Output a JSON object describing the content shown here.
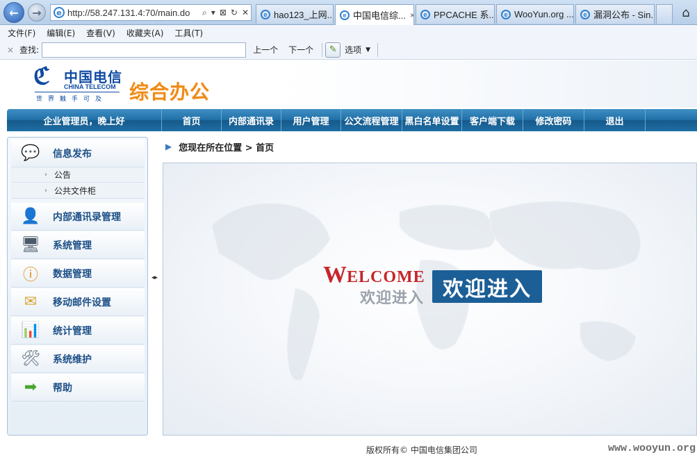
{
  "browser": {
    "address_url": "http://58.247.131.4:70/main.do",
    "address_controls": [
      "⌕",
      "▾",
      "⊠",
      "↻",
      "✕"
    ],
    "tabs": [
      {
        "title": "hao123_上网..."
      },
      {
        "title": "中国电信综...",
        "active": true,
        "close": "×"
      },
      {
        "title": "PPCACHE 系..."
      },
      {
        "title": "WooYun.org ..."
      },
      {
        "title": "漏洞公布 - Sin..."
      }
    ],
    "home_icon": "home-icon"
  },
  "menubar": {
    "items": [
      "文件(F)",
      "编辑(E)",
      "查看(V)",
      "收藏夹(A)",
      "工具(T)"
    ]
  },
  "findbar": {
    "close": "×",
    "label": "查找:",
    "input_value": "",
    "prev": "上一个",
    "next": "下一个",
    "options": "选项"
  },
  "header": {
    "logo_cn": "中国电信",
    "logo_en": "CHINA TELECOM",
    "logo_slogan": "世界触手可及",
    "app_title": "综合办公"
  },
  "nav": {
    "greeting": "企业管理员，晚上好",
    "items": [
      "首页",
      "内部通讯录",
      "用户管理",
      "公文流程管理",
      "黑白名单设置",
      "客户端下载",
      "修改密码",
      "退出"
    ]
  },
  "sidebar": {
    "groups": [
      {
        "label": "信息发布",
        "icon": "chat-bubbles-icon",
        "sub": [
          "公告",
          "公共文件柜"
        ]
      },
      {
        "label": "内部通讯录管理",
        "icon": "user-icon"
      },
      {
        "label": "系统管理",
        "icon": "monitor-icon"
      },
      {
        "label": "数据管理",
        "icon": "info-icon"
      },
      {
        "label": "移动邮件设置",
        "icon": "envelope-icon"
      },
      {
        "label": "统计管理",
        "icon": "bar-chart-icon"
      },
      {
        "label": "系统维护",
        "icon": "tools-icon"
      },
      {
        "label": "帮助",
        "icon": "arrow-right-icon"
      }
    ]
  },
  "breadcrumb": {
    "text": "您现在所在位置 > 首页"
  },
  "welcome": {
    "en_cap": "W",
    "en_rest": "ELCOME",
    "cn_grey": "欢迎进入",
    "cn_box": "欢迎进入"
  },
  "footer": {
    "copyright": "版权所有© 中国电信集团公司",
    "watermark": "www.wooyun.org"
  },
  "colors": {
    "nav_blue": "#1f6ea5",
    "title_orange": "#f08a16",
    "logo_blue": "#0f4aa2",
    "welcome_red": "#c6262b",
    "welcome_box": "#1c5f97"
  }
}
